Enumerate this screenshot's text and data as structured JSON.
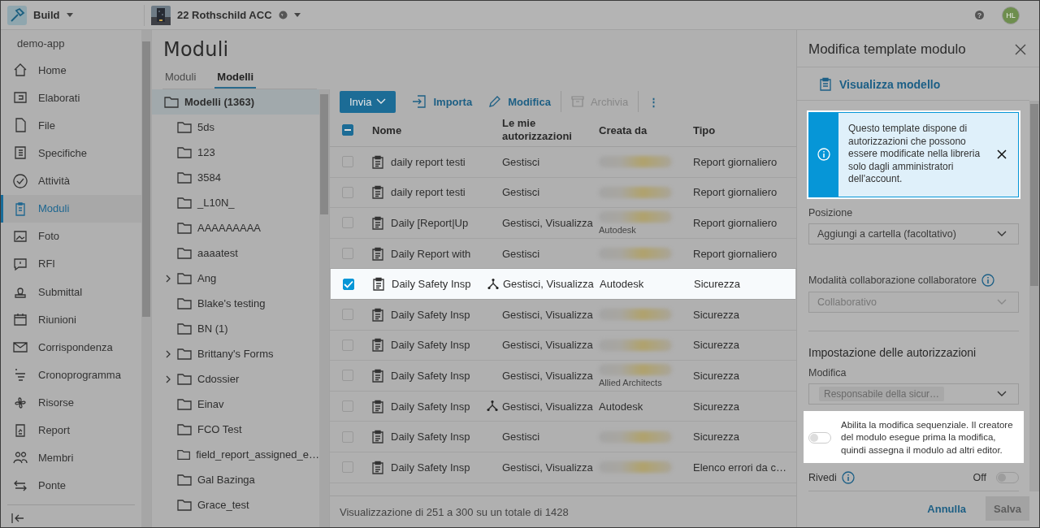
{
  "topbar": {
    "app": "Build",
    "project": "22 Rothschild ACC",
    "help": "?",
    "avatar": "HL"
  },
  "sidebar": {
    "account": "demo-app",
    "items": [
      {
        "label": "Home",
        "selected": false
      },
      {
        "label": "Elaborati",
        "selected": false
      },
      {
        "label": "File",
        "selected": false
      },
      {
        "label": "Specifiche",
        "selected": false
      },
      {
        "label": "Attività",
        "selected": false
      },
      {
        "label": "Moduli",
        "selected": true
      },
      {
        "label": "Foto",
        "selected": false
      },
      {
        "label": "RFI",
        "selected": false
      },
      {
        "label": "Submittal",
        "selected": false
      },
      {
        "label": "Riunioni",
        "selected": false
      },
      {
        "label": "Corrispondenza",
        "selected": false
      },
      {
        "label": "Cronoprogramma",
        "selected": false
      },
      {
        "label": "Risorse",
        "selected": false
      },
      {
        "label": "Report",
        "selected": false
      },
      {
        "label": "Membri",
        "selected": false
      },
      {
        "label": "Ponte",
        "selected": false
      }
    ]
  },
  "page": {
    "title": "Moduli",
    "tabs": [
      {
        "label": "Moduli",
        "selected": false
      },
      {
        "label": "Modelli",
        "selected": true
      }
    ]
  },
  "tree": {
    "root": {
      "label": "Modelli (1363)",
      "selected": true
    },
    "children": [
      {
        "label": "5ds",
        "expandable": false
      },
      {
        "label": "123",
        "expandable": false
      },
      {
        "label": "3584",
        "expandable": false
      },
      {
        "label": "_L10N_",
        "expandable": false
      },
      {
        "label": "AAAAAAAAA",
        "expandable": false
      },
      {
        "label": "aaaatest",
        "expandable": false
      },
      {
        "label": "Ang",
        "expandable": true
      },
      {
        "label": "Blake's testing",
        "expandable": false
      },
      {
        "label": "BN (1)",
        "expandable": false
      },
      {
        "label": "Brittany's Forms",
        "expandable": true
      },
      {
        "label": "Cdossier",
        "expandable": true
      },
      {
        "label": "Einav",
        "expandable": false
      },
      {
        "label": "FCO Test",
        "expandable": false
      },
      {
        "label": "field_report_assigned_e…",
        "expandable": false
      },
      {
        "label": "Gal Bazinga",
        "expandable": false
      },
      {
        "label": "Grace_test",
        "expandable": false
      }
    ]
  },
  "toolbar": [
    {
      "label": "Invia",
      "kind": "primary"
    },
    {
      "label": "Importa",
      "kind": "import"
    },
    {
      "label": "Modifica",
      "kind": "edit"
    },
    {
      "label": "Archivia",
      "kind": "archive",
      "disabled": true
    },
    {
      "label": "⋮",
      "kind": "more"
    }
  ],
  "table": {
    "select_all": {
      "indeterminate": true
    },
    "columns": [
      "Nome",
      "Le mie autorizzazioni",
      "Creata da",
      "Tipo"
    ],
    "rows": [
      {
        "name": "daily report testi",
        "shared": false,
        "permissions": "Gestisci",
        "redacted": true,
        "type": "Report giornaliero",
        "selected": false,
        "spotlight": false
      },
      {
        "name": "daily report testi",
        "shared": false,
        "permissions": "Gestisci",
        "redacted": true,
        "type": "Report giornaliero",
        "selected": false,
        "spotlight": false
      },
      {
        "name": "Daily [Report|Up",
        "shared": false,
        "permissions": "Gestisci, Visualizza",
        "redacted": true,
        "org": "Autodesk",
        "type": "Report giornaliero",
        "selected": false,
        "spotlight": false
      },
      {
        "name": "Daily Report with",
        "shared": false,
        "permissions": "Gestisci",
        "redacted": true,
        "type": "Report giornaliero",
        "selected": false,
        "spotlight": false
      },
      {
        "name": "Daily Safety Insp",
        "shared": true,
        "permissions": "Gestisci, Visualizza",
        "redacted": false,
        "creator": "Autodesk",
        "type": "Sicurezza",
        "selected": true,
        "spotlight": true
      },
      {
        "name": "Daily Safety Insp",
        "shared": false,
        "permissions": "Gestisci, Visualizza",
        "redacted": true,
        "type": "Sicurezza",
        "selected": false,
        "spotlight": false
      },
      {
        "name": "Daily Safety Insp",
        "shared": false,
        "permissions": "Gestisci, Visualizza",
        "redacted": true,
        "type": "Sicurezza",
        "selected": false,
        "spotlight": false
      },
      {
        "name": "Daily Safety Insp",
        "shared": false,
        "permissions": "Gestisci, Visualizza",
        "redacted": true,
        "org": "Allied Architects",
        "type": "Sicurezza",
        "selected": false,
        "spotlight": false
      },
      {
        "name": "Daily Safety Insp",
        "shared": true,
        "permissions": "Gestisci, Visualizza",
        "redacted": false,
        "creator": "Autodesk",
        "type": "Sicurezza",
        "selected": false,
        "spotlight": false
      },
      {
        "name": "Daily Safety Insp",
        "shared": false,
        "permissions": "Gestisci",
        "redacted": true,
        "type": "Sicurezza",
        "selected": false,
        "spotlight": false
      },
      {
        "name": "Daily Safety Insp",
        "shared": false,
        "permissions": "Gestisci, Visualizza",
        "redacted": true,
        "type": "Elenco errori da c…",
        "selected": false,
        "spotlight": false
      }
    ],
    "footer": "Visualizzazione di 251 a 300 su un totale di 1428"
  },
  "panel": {
    "title": "Modifica template modulo",
    "link": "Visualizza modello",
    "banner": {
      "text": "Questo template dispone di autorizzazioni che possono essere modificate nella libreria solo dagli amministratori dell'account.",
      "spotlight": true
    },
    "position": {
      "label": "Posizione",
      "placeholder": "Aggiungi a cartella (facoltativo)"
    },
    "collab": {
      "label": "Modalità collaborazione collaboratore",
      "value": "Collaborativo",
      "disabled": true
    },
    "permissions": {
      "heading": "Impostazione delle autorizzazioni",
      "label": "Modifica",
      "chip": "Responsabile della sicur…"
    },
    "sequential": {
      "text": "Abilita la modifica sequenziale. Il creatore del modulo esegue prima la modifica, quindi assegna il modulo ad altri editor.",
      "on": false,
      "spotlight": true
    },
    "review": {
      "label": "Rivedi",
      "state": "Off",
      "on": false
    },
    "buttons": [
      {
        "label": "Annulla",
        "kind": "link"
      },
      {
        "label": "Salva",
        "kind": "primary",
        "disabled": true
      }
    ]
  }
}
